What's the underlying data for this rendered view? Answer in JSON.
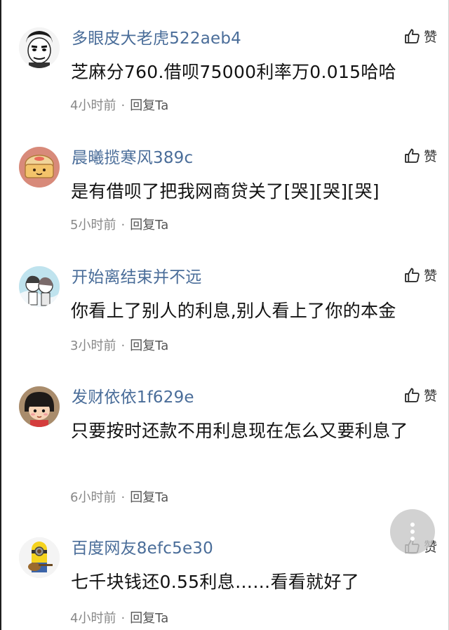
{
  "like_label": "赞",
  "reply_label": "回复Ta",
  "separator": "·",
  "comments": [
    {
      "username": "多眼皮大老虎522aeb4",
      "content": "芝麻分760.借呗75000利率万0.015哈哈",
      "time": "4小时前",
      "avatar_icon": "meme-face-avatar"
    },
    {
      "username": "晨曦揽寒风389c",
      "content": "是有借呗了把我网商贷关了[哭][哭][哭]",
      "time": "5小时前",
      "avatar_icon": "bread-cartoon-avatar"
    },
    {
      "username": "开始离结束并不远",
      "content": "你看上了别人的利息,别人看上了你的本金",
      "time": "3小时前",
      "avatar_icon": "anime-couple-avatar"
    },
    {
      "username": "发财依依1f629e",
      "content": "只要按时还款不用利息现在怎么又要利息了",
      "time": "6小时前",
      "avatar_icon": "cartoon-girl-avatar"
    },
    {
      "username": "百度网友8efc5e30",
      "content": "七千块钱还0.55利息……看看就好了",
      "time": "4小时前",
      "avatar_icon": "minion-guitar-avatar"
    }
  ],
  "colors": {
    "username": "#4a6d99",
    "meta": "#888888",
    "content": "#121212"
  }
}
